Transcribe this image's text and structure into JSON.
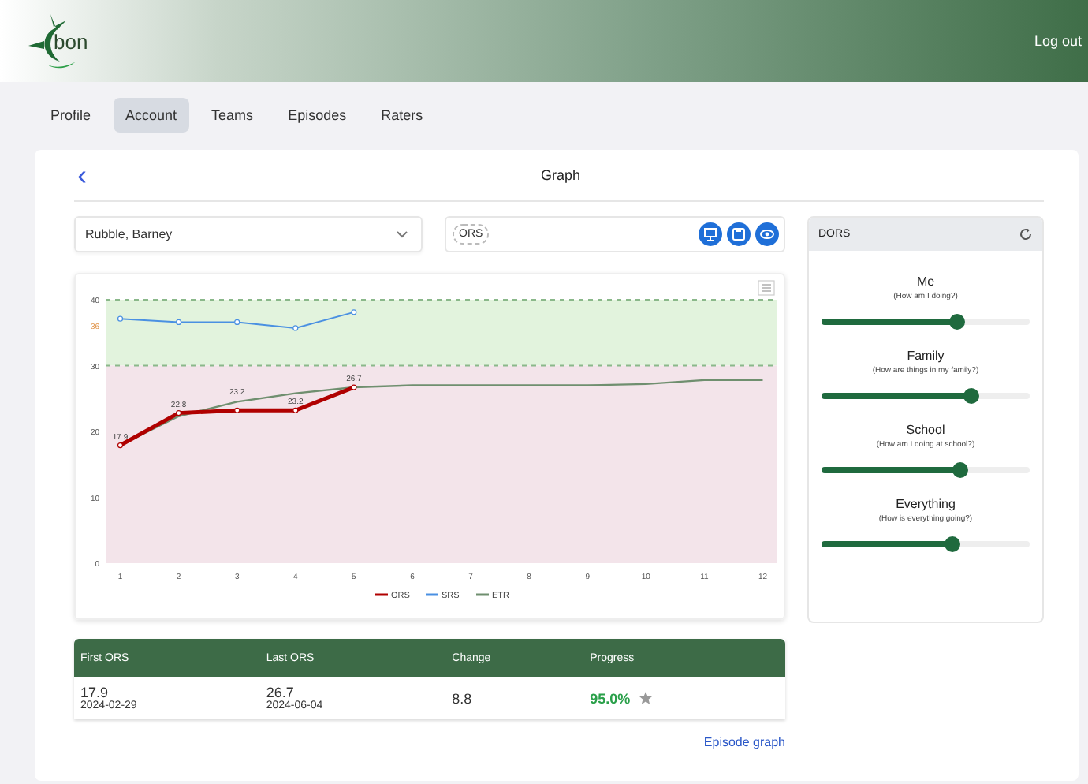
{
  "header": {
    "logo_text": "bon",
    "logout": "Log out"
  },
  "tabs": [
    {
      "label": "Profile",
      "selected": false
    },
    {
      "label": "Account",
      "selected": true
    },
    {
      "label": "Teams",
      "selected": false
    },
    {
      "label": "Episodes",
      "selected": false
    },
    {
      "label": "Raters",
      "selected": false
    }
  ],
  "page": {
    "back": "‹",
    "title": "Graph"
  },
  "client_select": {
    "value": "Rubble, Barney"
  },
  "measure_field": {
    "chip": "ORS"
  },
  "chart": {
    "chart_data": {
      "type": "line",
      "x": [
        1,
        2,
        3,
        4,
        5,
        6,
        7,
        8,
        9,
        10,
        11,
        12
      ],
      "series": [
        {
          "name": "ORS",
          "color": "#b00000",
          "marker": "circle",
          "values": [
            17.9,
            22.8,
            23.2,
            23.2,
            26.7,
            null,
            null,
            null,
            null,
            null,
            null,
            null
          ],
          "value_labels": [
            "17.9",
            "22.8",
            "23.2",
            "23.2",
            "26.7",
            null,
            null,
            null,
            null,
            null,
            null,
            null
          ]
        },
        {
          "name": "SRS",
          "color": "#4a90e2",
          "marker": "circle",
          "values": [
            37.1,
            36.6,
            36.6,
            35.7,
            38.1,
            null,
            null,
            null,
            null,
            null,
            null,
            null
          ]
        },
        {
          "name": "ETR",
          "color": "#6f8f6f",
          "values": [
            17.9,
            22.3,
            24.5,
            25.8,
            26.7,
            27,
            27,
            27,
            27,
            27.2,
            27.8,
            27.8
          ]
        }
      ],
      "xlim": [
        0.75,
        12.25
      ],
      "ylim": [
        0,
        40
      ],
      "xticks": [
        1,
        2,
        3,
        4,
        5,
        6,
        7,
        8,
        9,
        10,
        11,
        12
      ],
      "yticks": [
        0,
        10,
        20,
        30,
        40
      ],
      "bands": [
        {
          "axis": "y",
          "from": 30,
          "to": 40,
          "color": "#e2f3dd"
        },
        {
          "axis": "y",
          "from": 0,
          "to": 30,
          "color": "#f3e4ea"
        }
      ],
      "ref_lines": [
        {
          "axis": "y",
          "value": 40,
          "color": "#8ab88a"
        },
        {
          "axis": "y",
          "value": 30,
          "color": "#8ab88a"
        }
      ],
      "annotations": [
        "36"
      ],
      "legend": "bottom"
    }
  },
  "summary": {
    "columns": [
      "First ORS",
      "Last ORS",
      "Change",
      "Progress"
    ],
    "first": {
      "score": "17.9",
      "date": "2024-02-29"
    },
    "last": {
      "score": "26.7",
      "date": "2024-06-04"
    },
    "change": "8.8",
    "progress": "95.0%"
  },
  "episode_link": "Episode graph",
  "dors": {
    "title": "DORS",
    "items": [
      {
        "label": "Me",
        "hint": "(How am I doing?)",
        "level": 0.65
      },
      {
        "label": "Family",
        "hint": "(How are things in my family?)",
        "level": 0.72
      },
      {
        "label": "School",
        "hint": "(How am I doing at school?)",
        "level": 0.67
      },
      {
        "label": "Everything",
        "hint": "(How is everything going?)",
        "level": 0.63
      }
    ]
  }
}
